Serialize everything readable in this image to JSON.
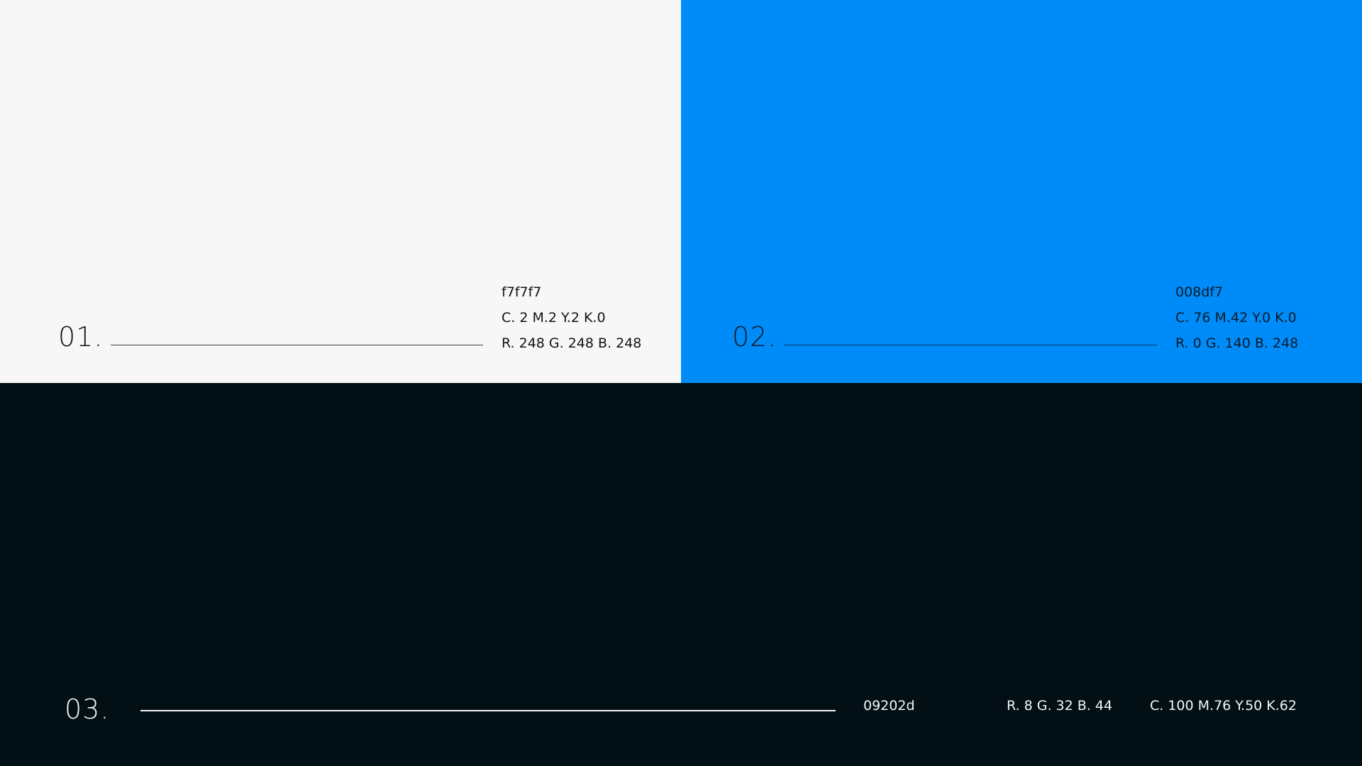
{
  "swatches": [
    {
      "number": "01.",
      "hex": "f7f7f7",
      "cmyk": "C. 2 M.2 Y.2 K.0",
      "rgb": "R. 248 G. 248 B. 248",
      "color": "#f7f7f7"
    },
    {
      "number": "02.",
      "hex": "008df7",
      "cmyk": "C. 76 M.42 Y.0 K.0",
      "rgb": "R. 0 G. 140 B. 248",
      "color": "#008cf8"
    },
    {
      "number": "03.",
      "hex": "09202d",
      "rgb": "R. 8 G. 32 B. 44",
      "cmyk": "C. 100 M.76 Y.50 K.62",
      "color": "#020f14"
    }
  ]
}
